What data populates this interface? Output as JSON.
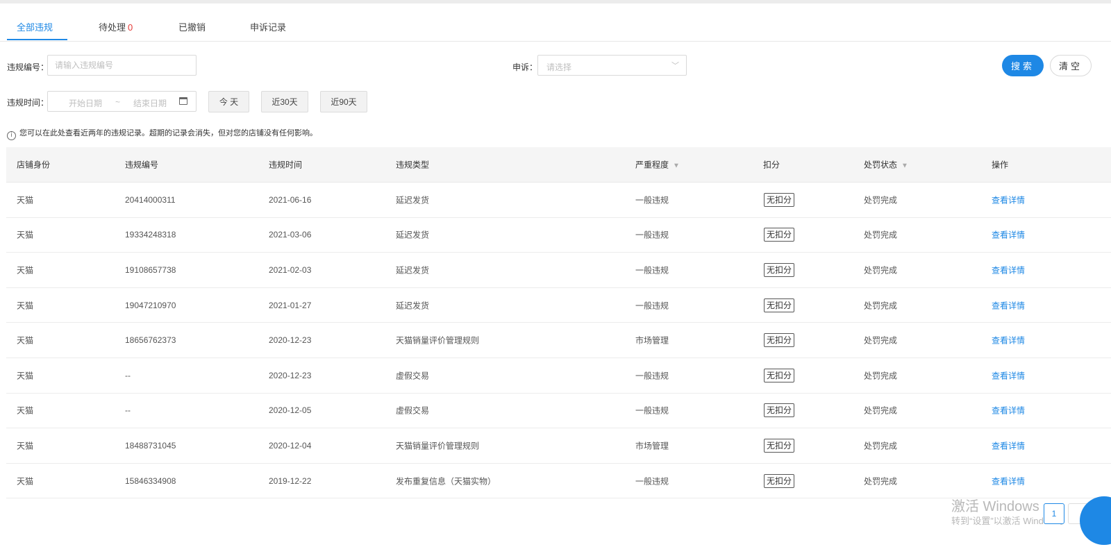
{
  "tabs": [
    {
      "label": "全部违规"
    },
    {
      "label": "待处理",
      "count": "0"
    },
    {
      "label": "已撤销"
    },
    {
      "label": "申诉记录"
    }
  ],
  "filters": {
    "violation_no_label": "违规编号：",
    "violation_no_placeholder": "请输入违规编号",
    "appeal_label": "申诉：",
    "appeal_placeholder": "请选择",
    "search_button": "搜索",
    "clear_button": "清空",
    "time_label": "违规时间：",
    "start_date_placeholder": "开始日期",
    "range_separator": "~",
    "end_date_placeholder": "结束日期",
    "quick_today": "今 天",
    "quick_30": "近30天",
    "quick_90": "近90天"
  },
  "notice": "您可以在此处查看近两年的违规记录。超期的记录会消失，但对您的店铺没有任何影响。",
  "table": {
    "headers": {
      "shop": "店铺身份",
      "no": "违规编号",
      "time": "违规时间",
      "type": "违规类型",
      "severity": "严重程度",
      "points": "扣分",
      "status": "处罚状态",
      "action": "操作"
    },
    "rows": [
      {
        "shop": "天猫",
        "no": "20414000311",
        "time": "2021-06-16",
        "type": "延迟发货",
        "severity": "一般违规",
        "points": "无扣分",
        "status": "处罚完成",
        "action": "查看详情"
      },
      {
        "shop": "天猫",
        "no": "19334248318",
        "time": "2021-03-06",
        "type": "延迟发货",
        "severity": "一般违规",
        "points": "无扣分",
        "status": "处罚完成",
        "action": "查看详情"
      },
      {
        "shop": "天猫",
        "no": "19108657738",
        "time": "2021-02-03",
        "type": "延迟发货",
        "severity": "一般违规",
        "points": "无扣分",
        "status": "处罚完成",
        "action": "查看详情"
      },
      {
        "shop": "天猫",
        "no": "19047210970",
        "time": "2021-01-27",
        "type": "延迟发货",
        "severity": "一般违规",
        "points": "无扣分",
        "status": "处罚完成",
        "action": "查看详情"
      },
      {
        "shop": "天猫",
        "no": "18656762373",
        "time": "2020-12-23",
        "type": "天猫销量评价管理规则",
        "severity": "市场管理",
        "points": "无扣分",
        "status": "处罚完成",
        "action": "查看详情"
      },
      {
        "shop": "天猫",
        "no": "--",
        "time": "2020-12-23",
        "type": "虚假交易",
        "severity": "一般违规",
        "points": "无扣分",
        "status": "处罚完成",
        "action": "查看详情"
      },
      {
        "shop": "天猫",
        "no": "--",
        "time": "2020-12-05",
        "type": "虚假交易",
        "severity": "一般违规",
        "points": "无扣分",
        "status": "处罚完成",
        "action": "查看详情"
      },
      {
        "shop": "天猫",
        "no": "18488731045",
        "time": "2020-12-04",
        "type": "天猫销量评价管理规则",
        "severity": "市场管理",
        "points": "无扣分",
        "status": "处罚完成",
        "action": "查看详情"
      },
      {
        "shop": "天猫",
        "no": "15846334908",
        "time": "2019-12-22",
        "type": "发布重复信息（天猫实物）",
        "severity": "一般违规",
        "points": "无扣分",
        "status": "处罚完成",
        "action": "查看详情"
      }
    ]
  },
  "pagination": {
    "current": "1"
  },
  "watermark": {
    "line1": "激活 Windows",
    "line2": "转到“设置”以激活 Windows。"
  },
  "colors": {
    "accent": "#1e88e5",
    "danger": "#e53935"
  }
}
